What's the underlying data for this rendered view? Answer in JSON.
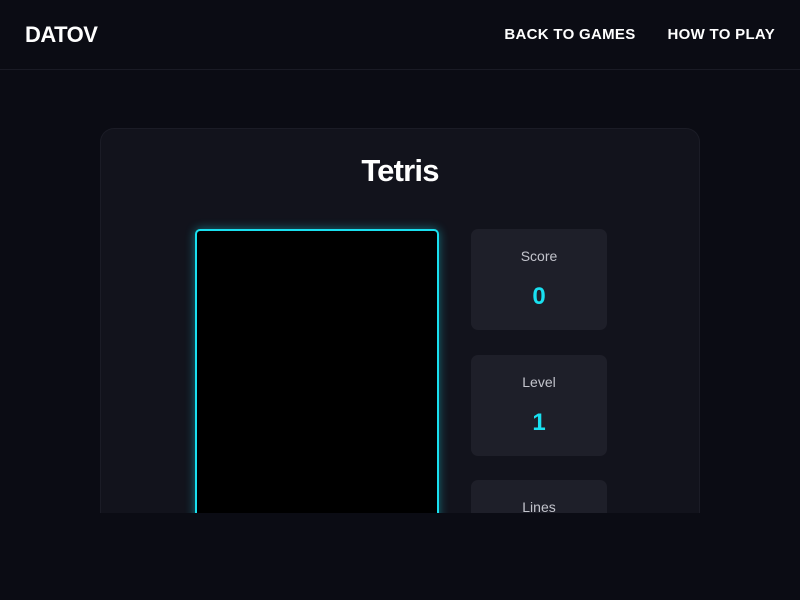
{
  "header": {
    "logo": "DATOV",
    "nav": [
      {
        "label": "BACK TO GAMES"
      },
      {
        "label": "HOW TO PLAY"
      }
    ]
  },
  "game": {
    "title": "Tetris",
    "board_border_color": "#19e0f0",
    "stats": {
      "score": {
        "label": "Score",
        "value": "0"
      },
      "level": {
        "label": "Level",
        "value": "1"
      },
      "lines": {
        "label": "Lines",
        "value": ""
      }
    }
  }
}
